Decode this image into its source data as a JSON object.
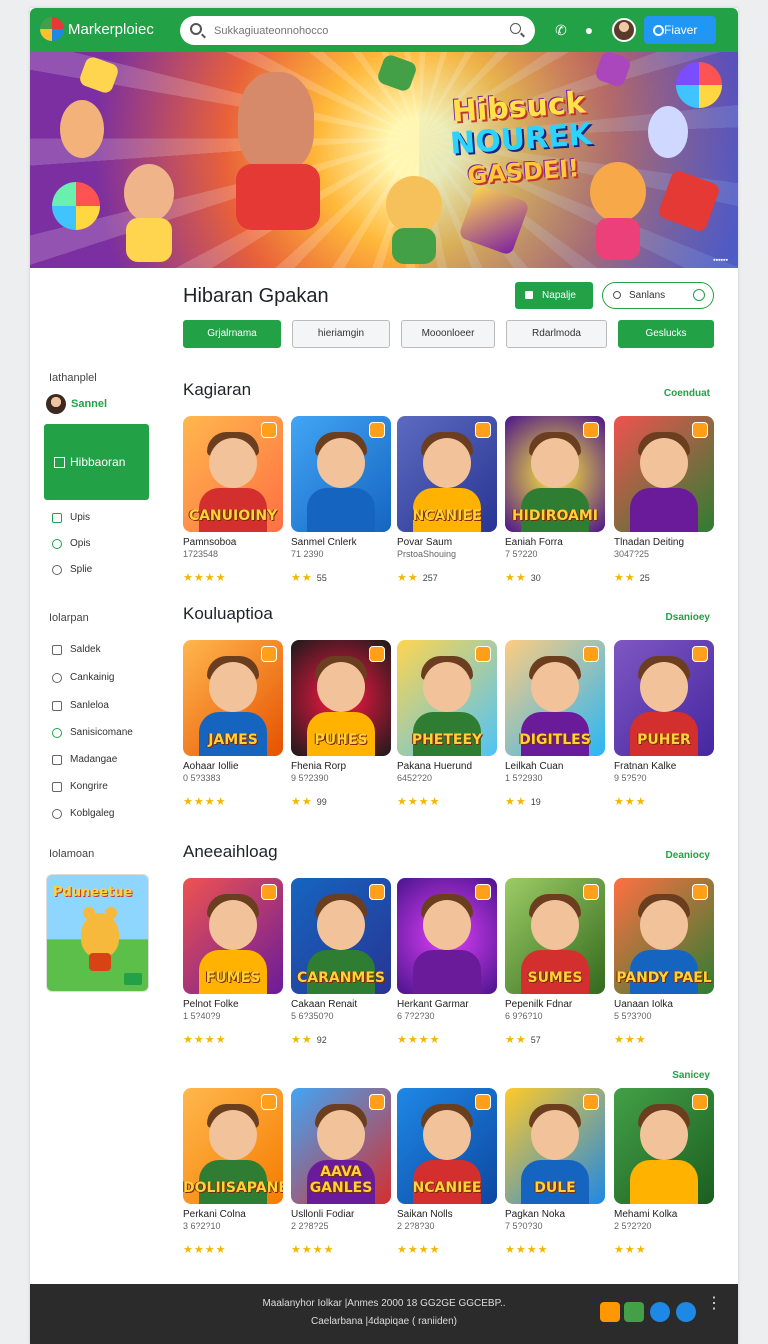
{
  "header": {
    "brand": "Markerploiec",
    "search_placeholder": "Sukkagiuateonnohocco",
    "button": "Fiaver"
  },
  "hero": {
    "title_lines": [
      "Hibsuck",
      "NOUREK",
      "GASDEI!"
    ],
    "corner_tag": "▪▪▪▪▪▪"
  },
  "main": {
    "title": "Hibaran Gpakan",
    "green_button": "Napalje",
    "search_button": "Sanlans",
    "chips": [
      "Grjalrnama",
      "hieriamgin",
      "Mooonloeer",
      "Rdarlmoda",
      "Geslucks"
    ]
  },
  "sidebar": {
    "section1": "Iathanplel",
    "user": "Sannel",
    "active": "Hibbaoran",
    "items1": [
      "Upis",
      "Opis",
      "Splie"
    ],
    "section2": "Iolarpan",
    "items2": [
      "Saldek",
      "Cankainig",
      "Sanleloa",
      "Sanisicomane",
      "Madangae",
      "Kongrire",
      "Koblgaleg"
    ],
    "section3": "Iolamoan",
    "promo_title": "Pduneetue"
  },
  "sections": [
    {
      "title": "Kagiaran",
      "link": "Coenduat",
      "cards": [
        {
          "label": "CANUIOINY",
          "t1": "Pamnsoboa",
          "t2": "1723548",
          "stars": "★★★★",
          "count": ""
        },
        {
          "label": "",
          "t1": "Sanmel Cnlerk",
          "t2": "71 2390",
          "stars": "★★",
          "count": "55"
        },
        {
          "label": "NCANIEE",
          "t1": "Povar Saum",
          "t2": "PrstoaShouing",
          "stars": "★★",
          "count": "257"
        },
        {
          "label": "HIDIROAMI",
          "t1": "Eaniah Forra",
          "t2": "7 5?220",
          "stars": "★★",
          "count": "30"
        },
        {
          "label": "",
          "t1": "Tlnadan Deiting",
          "t2": "3047?25",
          "stars": "★★",
          "count": "25"
        }
      ]
    },
    {
      "title": "Kouluaptioa",
      "link": "Dsanioey",
      "cards": [
        {
          "label": "JAMES",
          "t1": "Aohaar Iollie",
          "t2": "0 5?3383",
          "stars": "★★★★",
          "count": ""
        },
        {
          "label": "PUHES",
          "t1": "Fhenia Rorp",
          "t2": "9 5?2390",
          "stars": "★★",
          "count": "99"
        },
        {
          "label": "PHETEEY",
          "t1": "Pakana Huerund",
          "t2": "6452?20",
          "stars": "★★★★",
          "count": ""
        },
        {
          "label": "DIGITLES",
          "t1": "Leilkah Cuan",
          "t2": "1 5?2930",
          "stars": "★★",
          "count": "19"
        },
        {
          "label": "PUHER",
          "t1": "Fratnan Kalke",
          "t2": "9 5?5?0",
          "stars": "★★★",
          "count": ""
        }
      ]
    },
    {
      "title": "Aneeaihloag",
      "link": "Deaniocy",
      "cards": [
        {
          "label": "FUMES",
          "t1": "Pelnot Folke",
          "t2": "1 5?40?9",
          "stars": "★★★★",
          "count": ""
        },
        {
          "label": "CARANMES",
          "t1": "Cakaan Renait",
          "t2": "5 6?350?0",
          "stars": "★★",
          "count": "92"
        },
        {
          "label": "",
          "t1": "Herkant Garmar",
          "t2": "6 7?2?30",
          "stars": "★★★★",
          "count": ""
        },
        {
          "label": "SUMES",
          "t1": "Pepenilk Fdnar",
          "t2": "6 9?6?10",
          "stars": "★★",
          "count": "57"
        },
        {
          "label": "PANDY PAEL",
          "t1": "Uanaan Iolka",
          "t2": "5 5?3?00",
          "stars": "★★★",
          "count": ""
        }
      ]
    },
    {
      "title": "",
      "link": "Sanicey",
      "cards": [
        {
          "label": "DOLIISAPANE",
          "t1": "Perkani Colna",
          "t2": "3 6?2?10",
          "stars": "★★★★",
          "count": ""
        },
        {
          "label": "AAVA GANLES",
          "t1": "Usllonli Fodiar",
          "t2": "2 2?8?25",
          "stars": "★★★★",
          "count": ""
        },
        {
          "label": "NCANIEE",
          "t1": "Saikan Nolls",
          "t2": "2 2?8?30",
          "stars": "★★★★",
          "count": ""
        },
        {
          "label": "DULE",
          "t1": "Pagkan Noka",
          "t2": "7 5?0?30",
          "stars": "★★★★",
          "count": ""
        },
        {
          "label": "",
          "t1": "Mehami Kolka",
          "t2": "2 5?2?20",
          "stars": "★★★",
          "count": ""
        }
      ]
    }
  ],
  "footer": {
    "line1": "Maalanyhor Iolkar |Anmes 2000 18 GG2GE GGCEBP..",
    "line2": "Caelarbana |4dapiqae ( raniiden)"
  },
  "colors": {
    "accent": "#22a147",
    "header": "#22a147",
    "footer": "#2b2b2b",
    "button_blue": "#2196f3",
    "star": "#f2b705"
  }
}
